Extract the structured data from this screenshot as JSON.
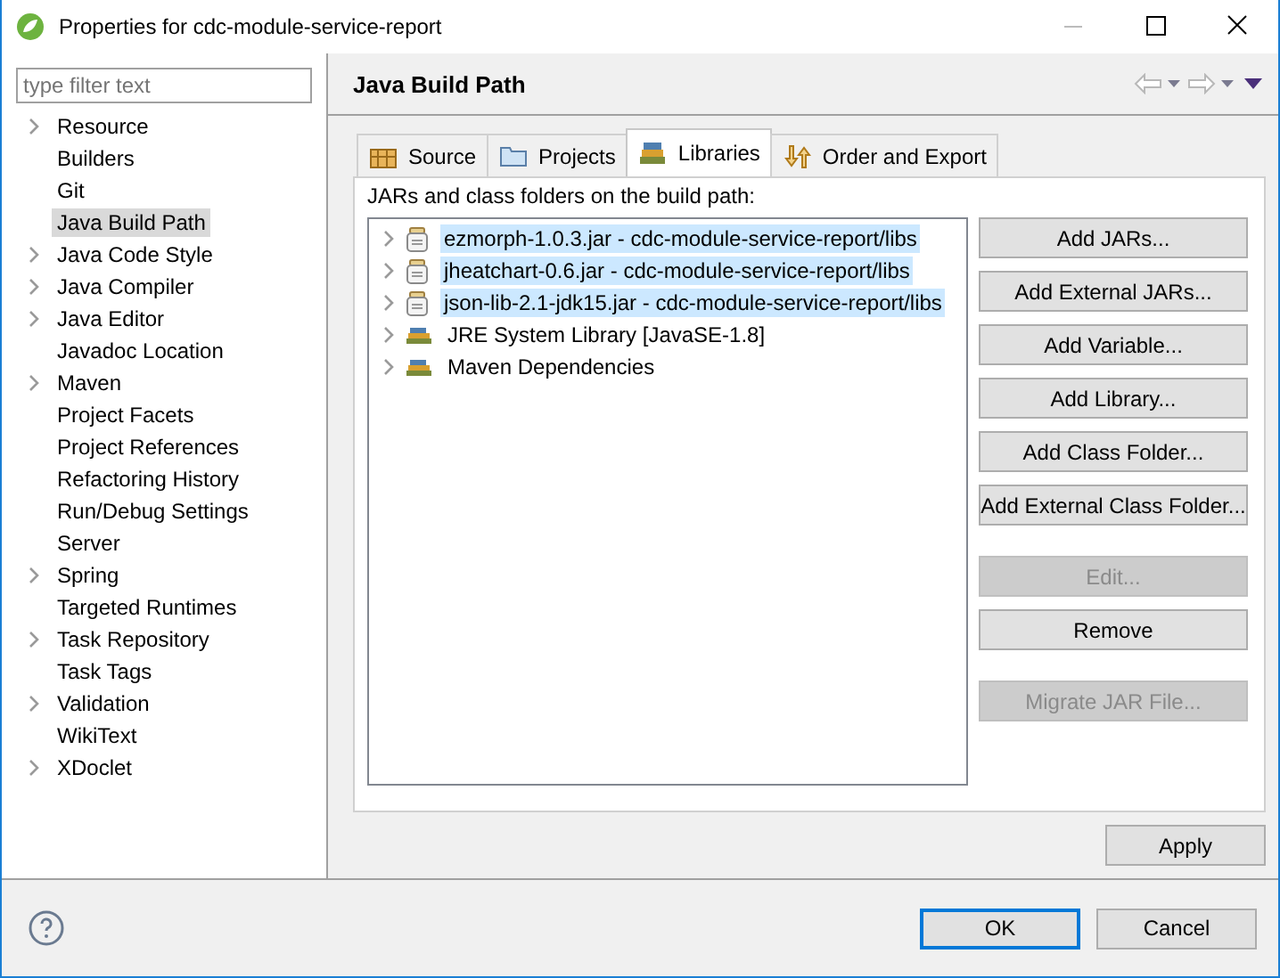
{
  "window": {
    "title": "Properties for cdc-module-service-report"
  },
  "filter": {
    "placeholder": "type filter text"
  },
  "sidebar": {
    "items": [
      {
        "label": "Resource",
        "expandable": true,
        "selected": false
      },
      {
        "label": "Builders",
        "expandable": false,
        "selected": false
      },
      {
        "label": "Git",
        "expandable": false,
        "selected": false
      },
      {
        "label": "Java Build Path",
        "expandable": false,
        "selected": true
      },
      {
        "label": "Java Code Style",
        "expandable": true,
        "selected": false
      },
      {
        "label": "Java Compiler",
        "expandable": true,
        "selected": false
      },
      {
        "label": "Java Editor",
        "expandable": true,
        "selected": false
      },
      {
        "label": "Javadoc Location",
        "expandable": false,
        "selected": false
      },
      {
        "label": "Maven",
        "expandable": true,
        "selected": false
      },
      {
        "label": "Project Facets",
        "expandable": false,
        "selected": false
      },
      {
        "label": "Project References",
        "expandable": false,
        "selected": false
      },
      {
        "label": "Refactoring History",
        "expandable": false,
        "selected": false
      },
      {
        "label": "Run/Debug Settings",
        "expandable": false,
        "selected": false
      },
      {
        "label": "Server",
        "expandable": false,
        "selected": false
      },
      {
        "label": "Spring",
        "expandable": true,
        "selected": false
      },
      {
        "label": "Targeted Runtimes",
        "expandable": false,
        "selected": false
      },
      {
        "label": "Task Repository",
        "expandable": true,
        "selected": false
      },
      {
        "label": "Task Tags",
        "expandable": false,
        "selected": false
      },
      {
        "label": "Validation",
        "expandable": true,
        "selected": false
      },
      {
        "label": "WikiText",
        "expandable": false,
        "selected": false
      },
      {
        "label": "XDoclet",
        "expandable": true,
        "selected": false
      }
    ]
  },
  "page": {
    "title": "Java Build Path"
  },
  "tabs": [
    {
      "label": "Source",
      "kind": "source",
      "selected": false
    },
    {
      "label": "Projects",
      "kind": "projects",
      "selected": false
    },
    {
      "label": "Libraries",
      "kind": "libraries",
      "selected": true
    },
    {
      "label": "Order and Export",
      "kind": "order",
      "selected": false
    }
  ],
  "libraries": {
    "caption": "JARs and class folders on the build path:",
    "items": [
      {
        "label": "ezmorph-1.0.3.jar - cdc-module-service-report/libs",
        "kind": "jar",
        "selected": true
      },
      {
        "label": "jheatchart-0.6.jar - cdc-module-service-report/libs",
        "kind": "jar",
        "selected": true
      },
      {
        "label": "json-lib-2.1-jdk15.jar - cdc-module-service-report/libs",
        "kind": "jar",
        "selected": true
      },
      {
        "label": "JRE System Library [JavaSE-1.8]",
        "kind": "library",
        "selected": false
      },
      {
        "label": "Maven Dependencies",
        "kind": "library",
        "selected": false
      }
    ],
    "buttons": [
      {
        "label": "Add JARs...",
        "disabled": false,
        "gap_before": false
      },
      {
        "label": "Add External JARs...",
        "disabled": false,
        "gap_before": false
      },
      {
        "label": "Add Variable...",
        "disabled": false,
        "gap_before": false
      },
      {
        "label": "Add Library...",
        "disabled": false,
        "gap_before": false
      },
      {
        "label": "Add Class Folder...",
        "disabled": false,
        "gap_before": false
      },
      {
        "label": "Add External Class Folder...",
        "disabled": false,
        "gap_before": false
      },
      {
        "label": "Edit...",
        "disabled": true,
        "gap_before": true
      },
      {
        "label": "Remove",
        "disabled": false,
        "gap_before": false
      },
      {
        "label": "Migrate JAR File...",
        "disabled": true,
        "gap_before": true
      }
    ]
  },
  "apply_button": "Apply",
  "buttons": [
    {
      "label": "OK",
      "default": true
    },
    {
      "label": "Cancel",
      "default": false
    }
  ]
}
